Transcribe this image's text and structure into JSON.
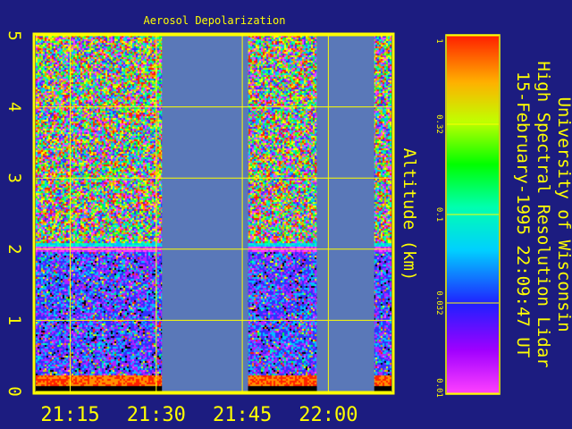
{
  "chart_data": {
    "type": "heatmap",
    "title": "Aerosol Depolarization",
    "ylabel": "Altitude (km)",
    "xlabel": "",
    "x_ticks": [
      "21:15",
      "21:30",
      "21:45",
      "22:00"
    ],
    "y_ticks": [
      "0",
      "1",
      "2",
      "3",
      "4",
      "5"
    ],
    "ylim": [
      0,
      5
    ],
    "grid": true,
    "colorbar": {
      "scale": "log",
      "range": [
        0.01,
        1
      ],
      "ticks": [
        "1",
        "0.32",
        "0.1",
        "0.032",
        "0.01"
      ],
      "colormap": "rainbow (magenta low, red high)"
    },
    "data_gaps": [
      {
        "from": "21:31",
        "to": "21:46"
      },
      {
        "from": "21:58",
        "to": "22:08"
      }
    ],
    "features": {
      "boundary_layer_top_km": 2.0,
      "surface_high_depolarization_km": [
        0,
        0.25
      ]
    }
  },
  "side_title": {
    "line1": "University of Wisconsin",
    "line2": "High Spectral Resolution Lidar",
    "line3": "15-February-1995 22:09:47 UT"
  },
  "colors": {
    "background": "#1c1c80",
    "axis": "#ffff00",
    "gap": "#5a78b8"
  }
}
